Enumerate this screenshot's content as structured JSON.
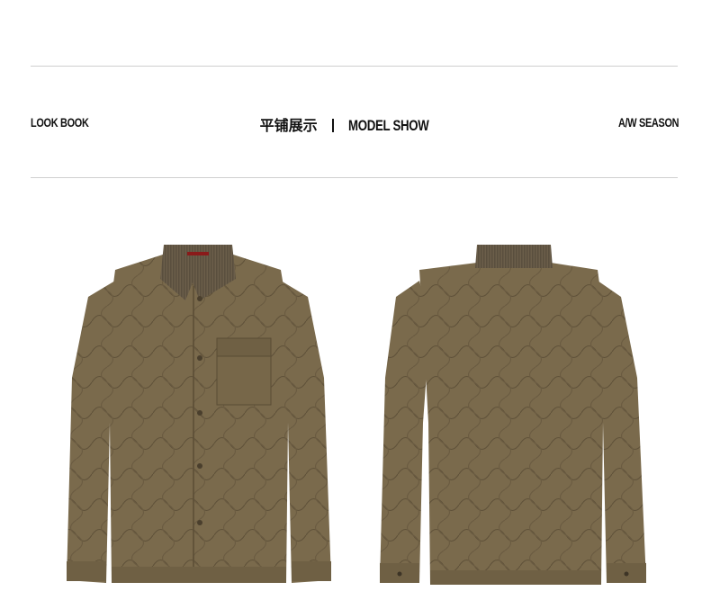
{
  "header": {
    "left_label": "LOOK BOOK",
    "center_cn": "平铺展示",
    "center_en": "MODEL SHOW",
    "right_label": "A/W SEASON"
  },
  "colors": {
    "jacket": "#7a6a4c",
    "jacket_dark": "#5e5038",
    "collar": "#6b5e4a",
    "rule": "#cfcfcf"
  },
  "images": {
    "front": "jacket-front-image",
    "back": "jacket-back-image"
  }
}
